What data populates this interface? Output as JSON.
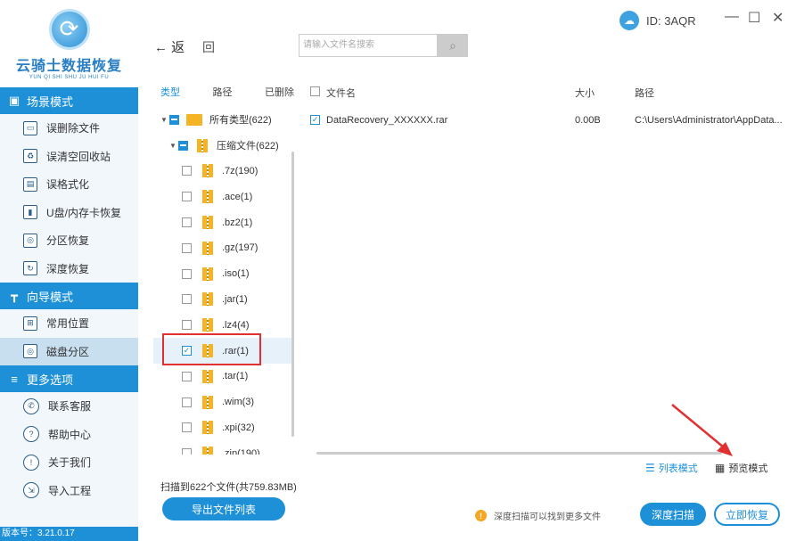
{
  "sidebar": {
    "logo_title": "云骑士数据恢复",
    "logo_subtitle": "YUN QI SHI SHU JU HUI FU",
    "sections": [
      {
        "title": "场景模式",
        "icon": "photo-icon"
      },
      {
        "title": "向导模式",
        "icon": "signpost-icon"
      },
      {
        "title": "更多选项",
        "icon": "menu-icon"
      }
    ],
    "scene_items": [
      {
        "label": "误删除文件",
        "icon": "delete-file-icon"
      },
      {
        "label": "误清空回收站",
        "icon": "recycle-bin-icon"
      },
      {
        "label": "误格式化",
        "icon": "save-icon"
      },
      {
        "label": "U盘/内存卡恢复",
        "icon": "usb-icon"
      },
      {
        "label": "分区恢复",
        "icon": "disk-icon"
      },
      {
        "label": "深度恢复",
        "icon": "deep-scan-icon"
      }
    ],
    "guide_items": [
      {
        "label": "常用位置",
        "icon": "windows-icon"
      },
      {
        "label": "磁盘分区",
        "icon": "disk-partition-icon"
      }
    ],
    "more_items": [
      {
        "label": "联系客服",
        "icon": "phone-icon"
      },
      {
        "label": "帮助中心",
        "icon": "question-icon"
      },
      {
        "label": "关于我们",
        "icon": "info-icon"
      },
      {
        "label": "导入工程",
        "icon": "import-icon"
      }
    ],
    "version": "版本号：3.21.0.17"
  },
  "topbar": {
    "back_label": "返",
    "home_label": "回",
    "search_placeholder": "请输入文件名搜索",
    "id_label": "ID: 3AQR"
  },
  "category_tabs": [
    "类型",
    "路径",
    "已删除"
  ],
  "tree": {
    "root": {
      "label": "所有类型(622)"
    },
    "group": {
      "label": "压缩文件(622)"
    },
    "items": [
      {
        "label": ".7z(190)",
        "checked": false
      },
      {
        "label": ".ace(1)",
        "checked": false
      },
      {
        "label": ".bz2(1)",
        "checked": false
      },
      {
        "label": ".gz(197)",
        "checked": false
      },
      {
        "label": ".iso(1)",
        "checked": false
      },
      {
        "label": ".jar(1)",
        "checked": false
      },
      {
        "label": ".lz4(4)",
        "checked": false
      },
      {
        "label": ".rar(1)",
        "checked": true
      },
      {
        "label": ".tar(1)",
        "checked": false
      },
      {
        "label": ".wim(3)",
        "checked": false
      },
      {
        "label": ".xpi(32)",
        "checked": false
      },
      {
        "label": ".zip(190)",
        "checked": false
      }
    ]
  },
  "file_list": {
    "headers": {
      "name": "文件名",
      "size": "大小",
      "path": "路径"
    },
    "rows": [
      {
        "name": "DataRecovery_XXXXXX.rar",
        "size": "0.00B",
        "path": "C:\\Users\\Administrator\\AppData..."
      }
    ]
  },
  "view_modes": {
    "list": "列表模式",
    "preview": "预览模式"
  },
  "bottom": {
    "scan_status": "扫描到622个文件(共759.83MB)",
    "export_label": "导出文件列表",
    "tip": "深度扫描可以找到更多文件",
    "deep_scan_label": "深度扫描",
    "recover_label": "立即恢复"
  },
  "colors": {
    "accent": "#1e90d8",
    "annotation": "#e03030"
  }
}
